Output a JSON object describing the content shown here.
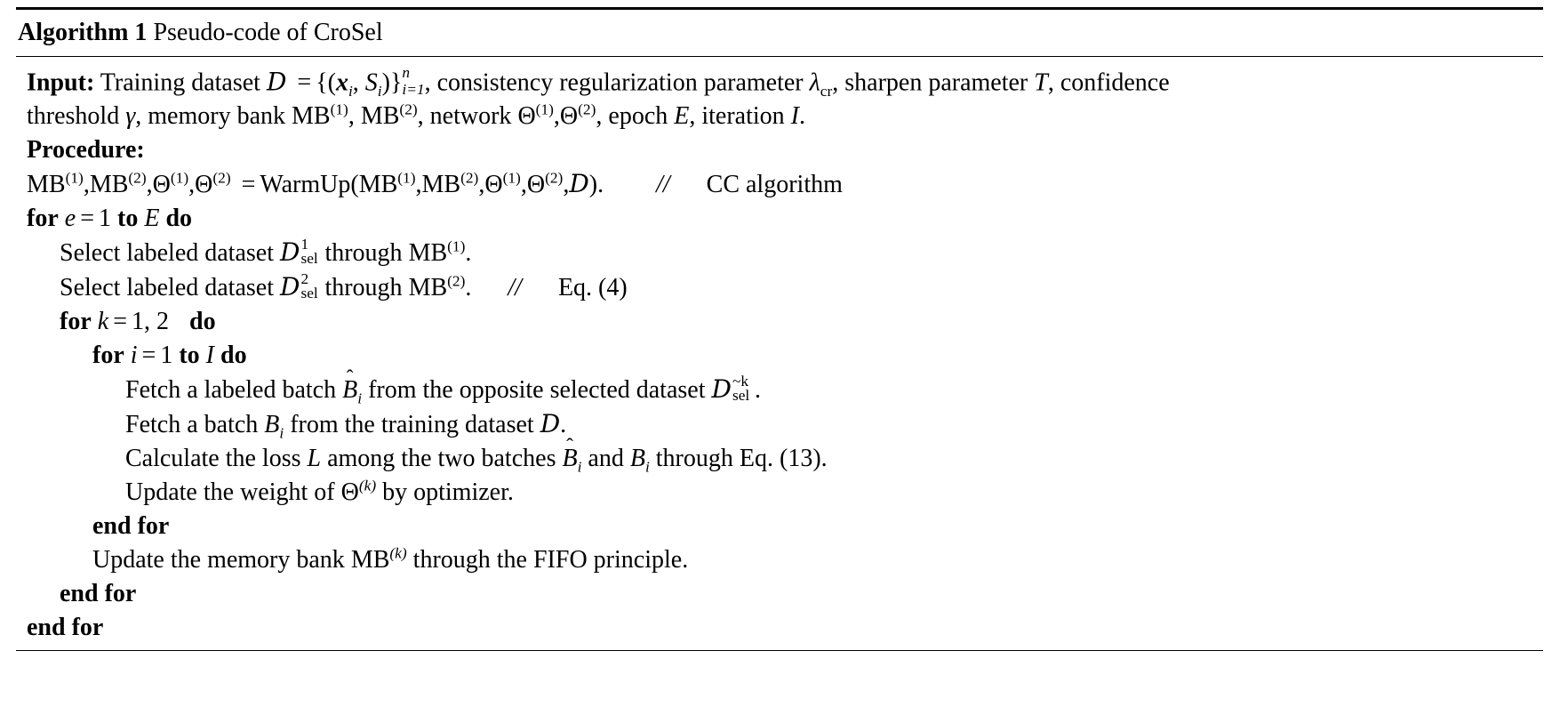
{
  "algorithm": {
    "caption_keyword": "Algorithm 1",
    "caption_text": "Pseudo-code of CroSel",
    "labels": {
      "input": "Input:",
      "procedure": "Procedure:",
      "for": "for",
      "to": "to",
      "do": "do",
      "end_for": "end for",
      "comment_marker": "//"
    },
    "lines": [
      {
        "id": "input",
        "indent": 0,
        "text": "Input: Training dataset D = {(x_i, S_i)}_{i=1}^{n}, consistency regularization parameter λ_cr, sharpen parameter T, confidence threshold γ, memory bank MB^(1), MB^(2), network Θ^(1), Θ^(2), epoch E, iteration I.",
        "segments": {
          "keyword": "Input:",
          "t1": "Training dataset",
          "cal_D": "D",
          "eq": "=",
          "set_open": "{(",
          "x": "x",
          "xi_sub": "i",
          "comma1": ",",
          "S": "S",
          "Si_sub": "i",
          "set_close": ")}",
          "sup_n": "n",
          "sub_i1": "i=1",
          "t2": ", consistency regularization parameter",
          "lambda": "λ",
          "lambda_sub": "cr",
          "t3": ", sharpen parameter",
          "T": "T",
          "t4": ", confidence",
          "t5": "threshold",
          "gamma": "γ",
          "t6": ", memory bank",
          "MB": "MB",
          "sup1": "(1)",
          "comma2": ",",
          "sup2": "(2)",
          "t7": ", network",
          "Theta": "Θ",
          "t8": ", epoch",
          "E": "E",
          "t9": ", iteration",
          "I": "I",
          "period": "."
        }
      },
      {
        "id": "procedure",
        "indent": 0,
        "keyword": "Procedure:"
      },
      {
        "id": "warmup",
        "indent": 0,
        "text": "MB^(1), MB^(2), Θ^(1), Θ^(2) = WarmUp(MB^(1), MB^(2), Θ^(1), Θ^(2), D).    //   CC algorithm",
        "comment": "CC algorithm",
        "func": "WarmUp"
      },
      {
        "id": "for-e",
        "indent": 0,
        "var": "e",
        "start": "1",
        "limit": "E",
        "text": "for e = 1 to E do"
      },
      {
        "id": "select-1",
        "indent": 1,
        "text": "Select labeled dataset D^1_sel through MB^(1).",
        "prefix": "Select labeled dataset",
        "sup": "1",
        "sub": "sel",
        "middle": "through",
        "bank": "MB",
        "bank_sup": "(1)",
        "period": "."
      },
      {
        "id": "select-2",
        "indent": 1,
        "text": "Select labeled dataset D^2_sel through MB^(2).    //   Eq. (4)",
        "prefix": "Select labeled dataset",
        "sup": "2",
        "sub": "sel",
        "middle": "through",
        "bank": "MB",
        "bank_sup": "(2)",
        "period": ".",
        "comment": "Eq. (4)"
      },
      {
        "id": "for-k",
        "indent": 1,
        "var": "k",
        "values": "1, 2",
        "text": "for k = 1, 2  do"
      },
      {
        "id": "for-i",
        "indent": 2,
        "var": "i",
        "start": "1",
        "limit": "I",
        "text": "for i = 1 to I do"
      },
      {
        "id": "fetch-labeled-batch",
        "indent": 3,
        "text": "Fetch a labeled batch B̂_i from the opposite selected dataset D^{~k}_sel.",
        "prefix": "Fetch a labeled batch",
        "batch": "B",
        "batch_sub": "i",
        "middle": "from the opposite selected dataset",
        "sup": "~k",
        "sub": "sel",
        "period": "."
      },
      {
        "id": "fetch-batch",
        "indent": 3,
        "text": "Fetch a batch B_i from the training dataset D.",
        "prefix": "Fetch a batch",
        "batch": "B",
        "batch_sub": "i",
        "middle": "from the training dataset",
        "cal_D": "D",
        "period": "."
      },
      {
        "id": "calculate-loss",
        "indent": 3,
        "text": "Calculate the loss L among the two batches B̂_i and B_i through Eq. (13).",
        "p1": "Calculate the loss",
        "L": "L",
        "p2": "among the two batches",
        "p3": "and",
        "p4": "through Eq. (13)."
      },
      {
        "id": "update-weight",
        "indent": 3,
        "text": "Update the weight of Θ^(k) by optimizer.",
        "p1": "Update the weight of",
        "Theta": "Θ",
        "sup": "(k)",
        "p2": "by optimizer."
      },
      {
        "id": "end-for-i",
        "indent": 2,
        "keyword": "end for"
      },
      {
        "id": "update-memory-bank",
        "indent": 2,
        "text": "Update the memory bank MB^(k) through the FIFO principle.",
        "p1": "Update the memory bank",
        "bank": "MB",
        "sup": "(k)",
        "p2": "through the FIFO principle."
      },
      {
        "id": "end-for-k",
        "indent": 1,
        "keyword": "end for"
      },
      {
        "id": "end-for-e",
        "indent": 0,
        "keyword": "end for"
      }
    ]
  },
  "style": {
    "background": "#ffffff",
    "text_color": "#000000"
  }
}
